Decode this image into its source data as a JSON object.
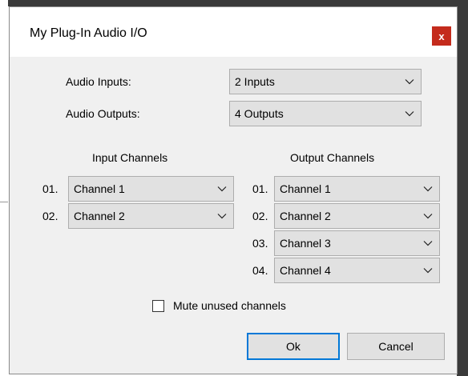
{
  "window": {
    "title": "My Plug-In Audio I/O",
    "close_label": "x"
  },
  "audio_inputs": {
    "label": "Audio Inputs:",
    "value": "2 Inputs"
  },
  "audio_outputs": {
    "label": "Audio Outputs:",
    "value": "4 Outputs"
  },
  "input_channels": {
    "header": "Input Channels",
    "rows": [
      {
        "index": "01.",
        "value": "Channel 1"
      },
      {
        "index": "02.",
        "value": "Channel 2"
      }
    ]
  },
  "output_channels": {
    "header": "Output Channels",
    "rows": [
      {
        "index": "01.",
        "value": "Channel 1"
      },
      {
        "index": "02.",
        "value": "Channel 2"
      },
      {
        "index": "03.",
        "value": "Channel 3"
      },
      {
        "index": "04.",
        "value": "Channel 4"
      }
    ]
  },
  "mute_unused": {
    "label": "Mute unused channels",
    "checked": false
  },
  "buttons": {
    "ok": "Ok",
    "cancel": "Cancel"
  },
  "icons": {
    "dropdown": "chevron-down-icon",
    "close": "close-icon"
  },
  "colors": {
    "dialog_bg": "#f0f0f0",
    "title_bg": "#ffffff",
    "close_bg": "#c42b1c",
    "control_bg": "#e1e1e1",
    "control_border": "#adadad",
    "default_button_border": "#0078d7"
  }
}
